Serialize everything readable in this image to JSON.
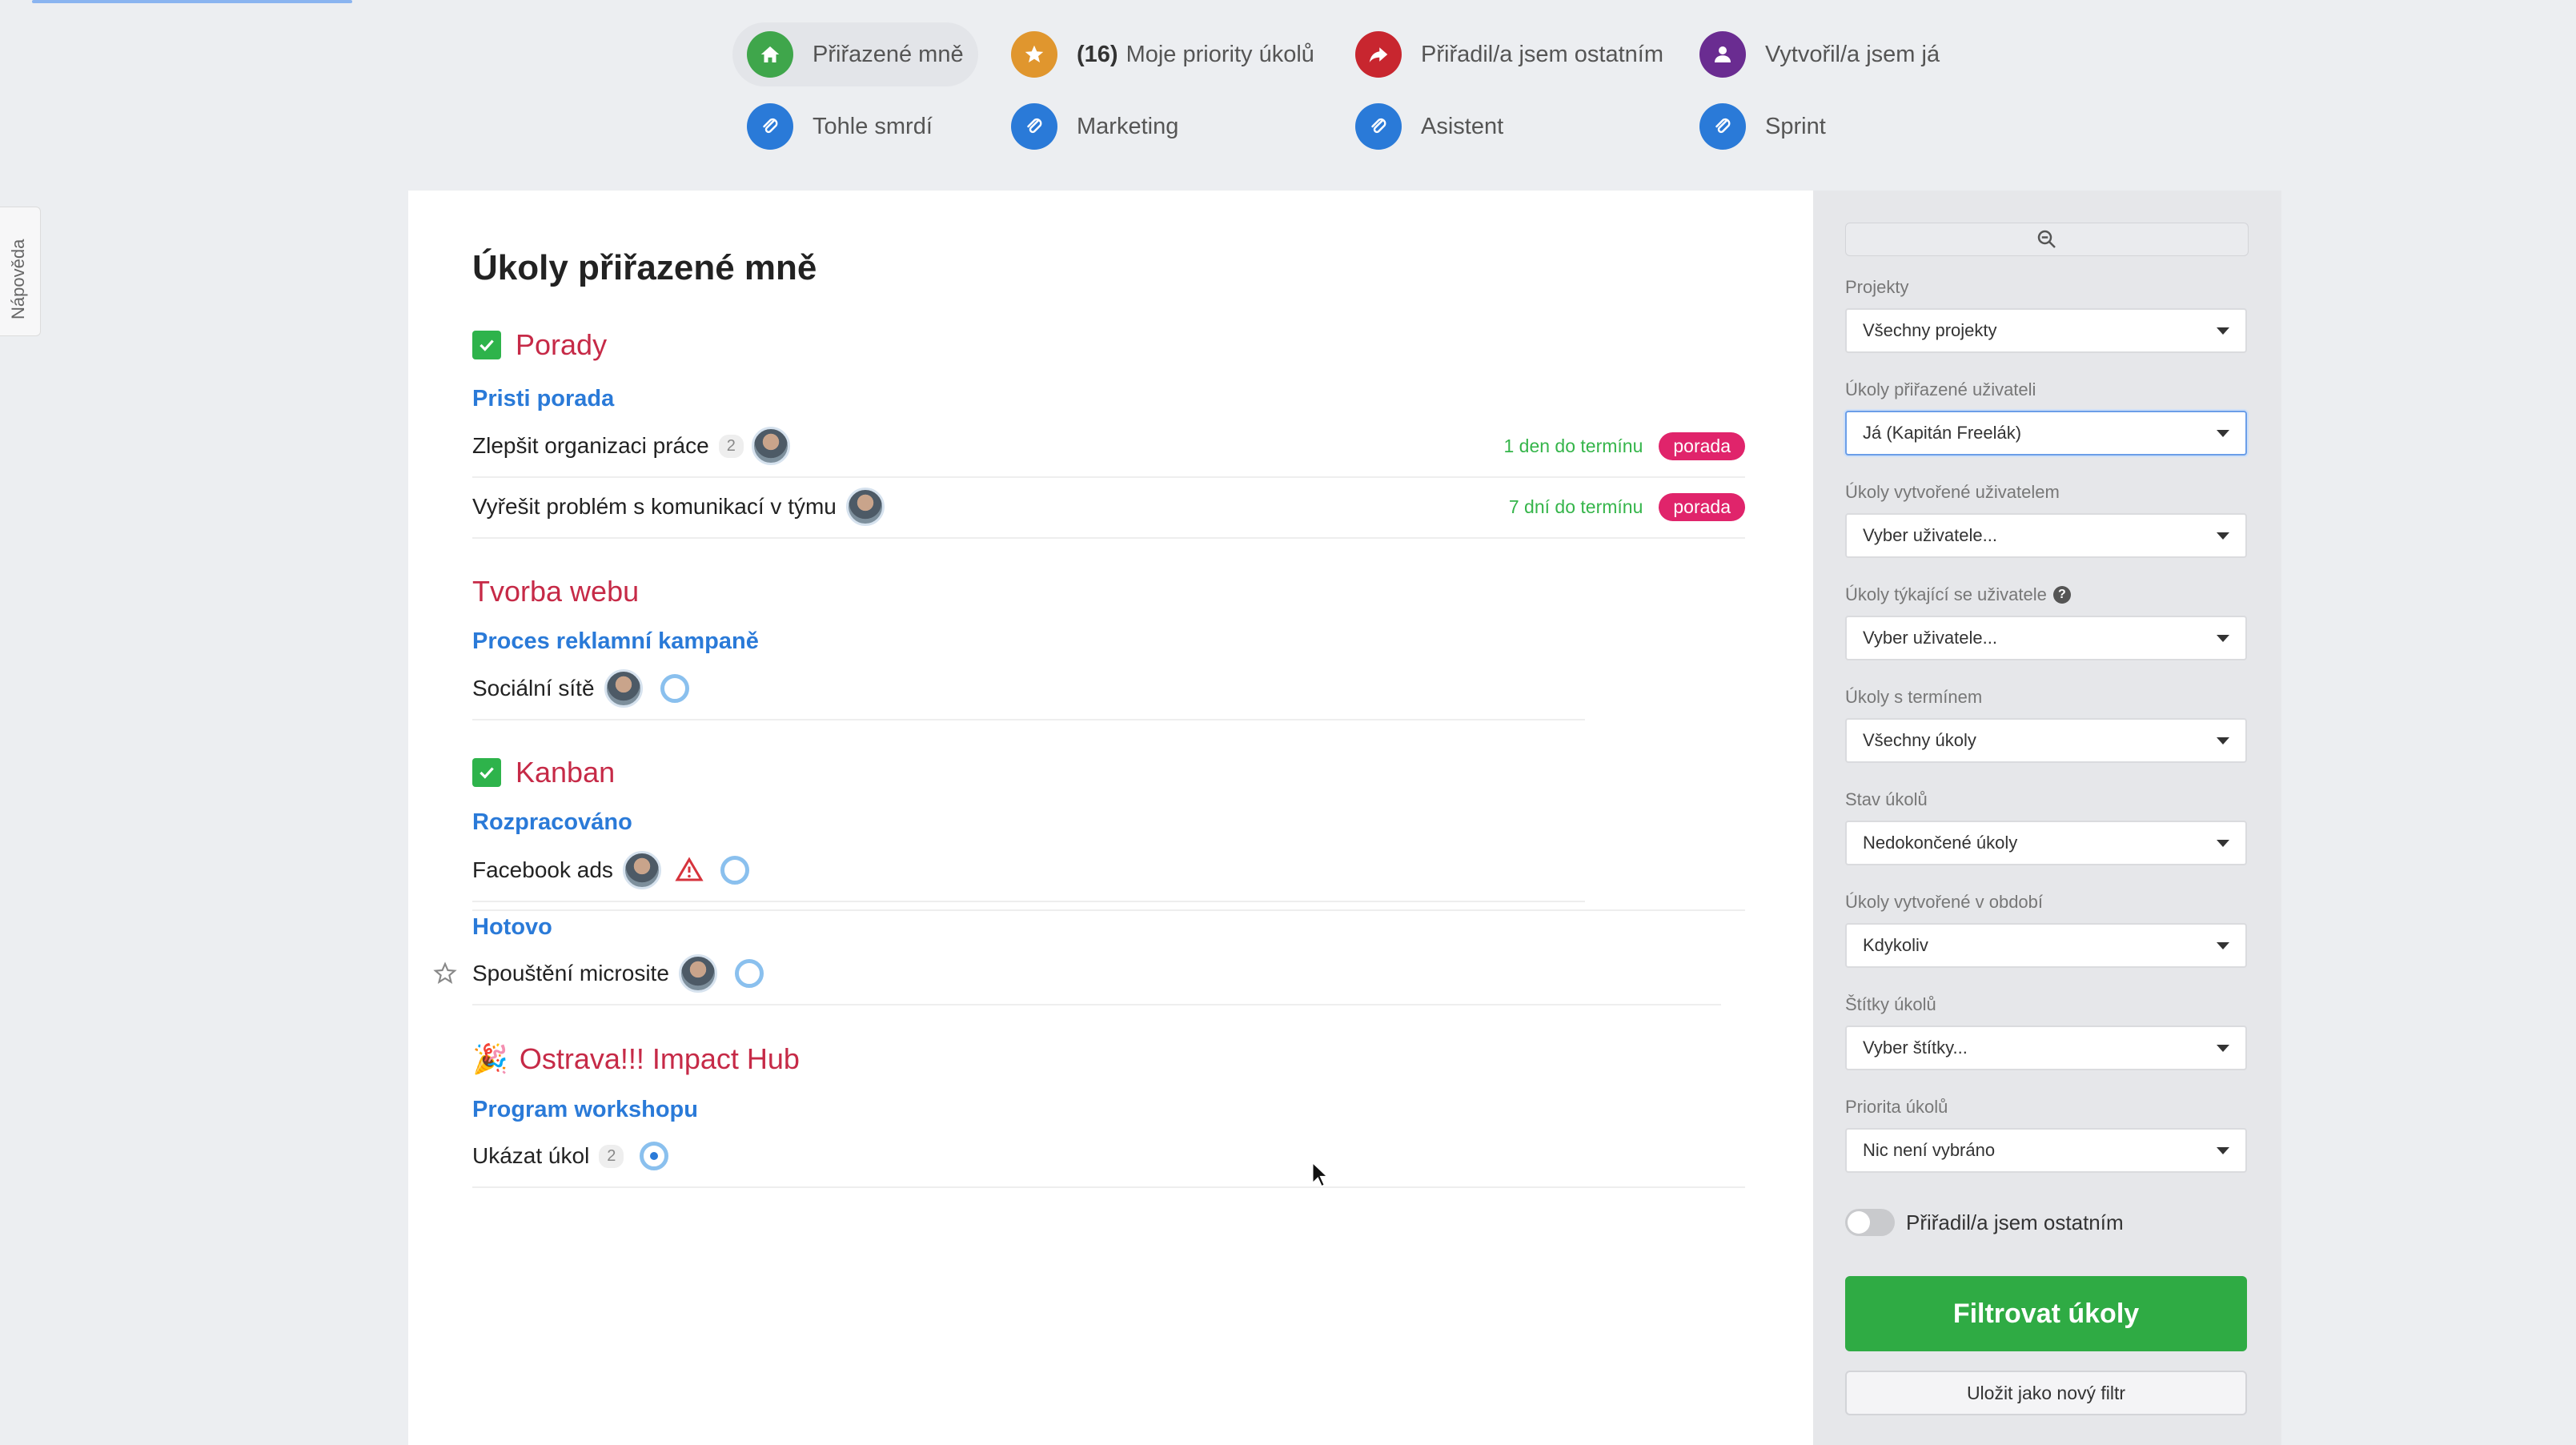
{
  "nav": {
    "items": [
      {
        "label": "Přiřazené mně",
        "icon": "home-icon",
        "color": "#3fa64b"
      },
      {
        "count": "(16)",
        "label": "Moje priority úkolů",
        "icon": "star-icon",
        "color": "#e0962e"
      },
      {
        "label": "Přiřadil/a jsem ostatním",
        "icon": "forward-arrow-icon",
        "color": "#c8262f"
      },
      {
        "label": "Vytvořil/a jsem já",
        "icon": "user-icon",
        "color": "#6a2c91"
      },
      {
        "label": "Tohle smrdí",
        "icon": "paperclip-icon",
        "color": "#2a7ad8"
      },
      {
        "label": "Marketing",
        "icon": "paperclip-icon",
        "color": "#2a7ad8"
      },
      {
        "label": "Asistent",
        "icon": "paperclip-icon",
        "color": "#2a7ad8"
      },
      {
        "label": "Sprint",
        "icon": "paperclip-icon",
        "color": "#2a7ad8"
      }
    ]
  },
  "help_tab": "Nápověda",
  "main": {
    "title": "Úkoly přiřazené mně",
    "projects": [
      {
        "name": "Porady",
        "icon": "checkbox-icon",
        "lists": [
          {
            "name": "Pristi porada",
            "tasks": [
              {
                "name": "Zlepšit organizaci práce",
                "count": "2",
                "deadline": "1 den do termínu",
                "tag": "porada"
              },
              {
                "name": "Vyřešit problém s komunikací v týmu",
                "deadline": "7 dní do termínu",
                "tag": "porada"
              }
            ]
          }
        ]
      },
      {
        "name": "Tvorba webu",
        "lists": [
          {
            "name": "Proces reklamní kampaně",
            "tasks": [
              {
                "name": "Sociální sítě"
              }
            ]
          }
        ]
      },
      {
        "name": "Kanban",
        "icon": "checkbox-icon",
        "lists": [
          {
            "name": "Rozpracováno",
            "tasks": [
              {
                "name": "Facebook ads",
                "warning": true
              }
            ]
          },
          {
            "name": "Hotovo",
            "tasks": [
              {
                "name": "Spouštění microsite"
              }
            ]
          }
        ]
      },
      {
        "name": "Ostrava!!! Impact Hub",
        "icon": "party-popper-icon",
        "lists": [
          {
            "name": "Program workshopu",
            "tasks": [
              {
                "name": "Ukázat úkol",
                "count": "2"
              }
            ]
          }
        ]
      }
    ]
  },
  "sidebar": {
    "filters": [
      {
        "label": "Projekty",
        "value": "Všechny projekty"
      },
      {
        "label": "Úkoly přiřazené uživateli",
        "value": "Já (Kapitán Freelák)"
      },
      {
        "label": "Úkoly vytvořené uživatelem",
        "value": "Vyber uživatele..."
      },
      {
        "label": "Úkoly týkající se uživatele",
        "value": "Vyber uživatele..."
      },
      {
        "label": "Úkoly s termínem",
        "value": "Všechny úkoly"
      },
      {
        "label": "Stav úkolů",
        "value": "Nedokončené úkoly"
      },
      {
        "label": "Úkoly vytvořené v období",
        "value": "Kdykoliv"
      },
      {
        "label": "Štítky úkolů",
        "value": "Vyber štítky..."
      },
      {
        "label": "Priorita úkolů",
        "value": "Nic není vybráno"
      }
    ],
    "toggle_label": "Přiřadil/a jsem ostatním",
    "filter_button": "Filtrovat úkoly",
    "save_button": "Uložit jako nový filtr"
  },
  "colors": {
    "accent_blue": "#2a7ad8",
    "project_red": "#c62a47",
    "deadline_green": "#35b54a",
    "tag_pink": "#e0246b",
    "button_green": "#2fab44"
  }
}
